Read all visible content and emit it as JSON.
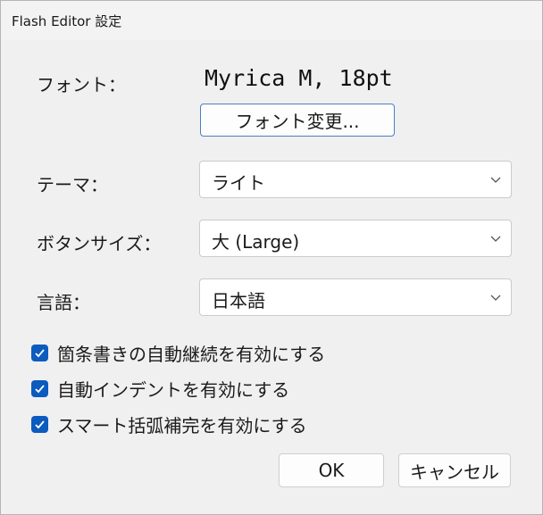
{
  "window": {
    "title": "Flash Editor 設定"
  },
  "font": {
    "label": "フォント：",
    "value": "Myrica M, 18pt",
    "change_button": "フォント変更..."
  },
  "theme": {
    "label": "テーマ：",
    "selected": "ライト"
  },
  "button_size": {
    "label": "ボタンサイズ：",
    "selected": "大 (Large)"
  },
  "language": {
    "label": "言語：",
    "selected": "日本語"
  },
  "options": [
    {
      "label": "箇条書きの自動継続を有効にする",
      "checked": true
    },
    {
      "label": "自動インデントを有効にする",
      "checked": true
    },
    {
      "label": "スマート括弧補完を有効にする",
      "checked": true
    }
  ],
  "buttons": {
    "ok": "OK",
    "cancel": "キャンセル"
  },
  "colors": {
    "accent": "#0c5bbf",
    "focus_border": "#4a7fc6"
  },
  "icons": {
    "dropdown": "chevron-down-icon",
    "check": "checkmark-icon"
  }
}
